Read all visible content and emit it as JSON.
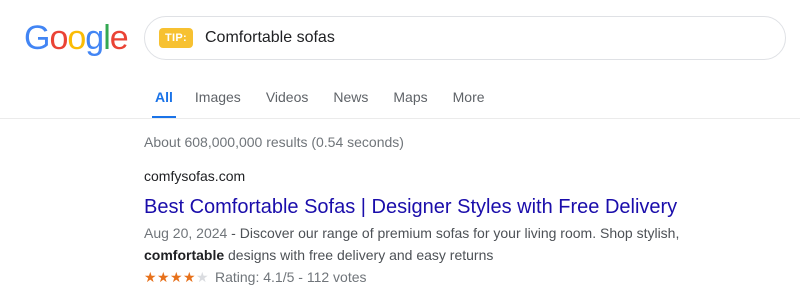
{
  "logo": {
    "letters": [
      "G",
      "o",
      "o",
      "g",
      "l",
      "e"
    ],
    "colors": [
      "#4285F4",
      "#EA4335",
      "#FBBC05",
      "#4285F4",
      "#34A853",
      "#EA4335"
    ]
  },
  "search": {
    "badge": "TIP:",
    "query": "Comfortable sofas"
  },
  "tabs": [
    {
      "label": "All",
      "active": true
    },
    {
      "label": "Images"
    },
    {
      "label": "Videos"
    },
    {
      "label": "News"
    },
    {
      "label": "Maps"
    },
    {
      "label": "More"
    }
  ],
  "stats": "About 608,000,000 results (0.54 seconds)",
  "result": {
    "site": "comfysofas.com",
    "title": "Best Comfortable Sofas | Designer Styles with Free Delivery",
    "date": "Aug 20, 2024",
    "snippet_part1": " - Discover our range of premium sofas for your living room. Shop stylish,",
    "snippet_bold": "comfortable",
    "snippet_part2": " designs with free delivery and easy returns",
    "rating_text": "Rating: 4.1/5 - 112 votes",
    "rating_value": 4.1,
    "rating_max": 5,
    "star_filled_color": "#e7711b",
    "star_empty_color": "#dadce0"
  }
}
